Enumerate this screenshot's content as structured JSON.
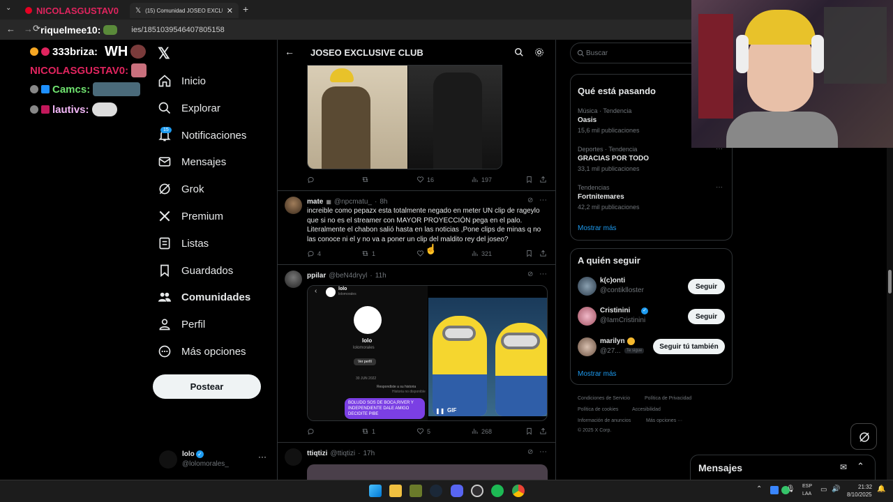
{
  "browser": {
    "tab1_label": "NICOLASGUSTAV0",
    "tab2_label": "(15) Comunidad JOSEO EXCLUS",
    "url_overlay": "riquelmee10:",
    "url": "ies/1851039546407805158"
  },
  "chat": {
    "lines": [
      {
        "user": "333briza:",
        "text": "WH",
        "color": "#ffffff"
      },
      {
        "user": "NICOLASGUSTAV0:",
        "text": "",
        "color": "#e0245e"
      },
      {
        "user": "Camcs:",
        "text": "",
        "color": "#6fe36f"
      },
      {
        "user": "lautivs:",
        "text": "",
        "color": "#f2b7f7"
      }
    ]
  },
  "nav": {
    "items": [
      {
        "label": "Inicio",
        "icon": "home-icon"
      },
      {
        "label": "Explorar",
        "icon": "search-icon"
      },
      {
        "label": "Notificaciones",
        "icon": "bell-icon",
        "badge": "15"
      },
      {
        "label": "Mensajes",
        "icon": "mail-icon"
      },
      {
        "label": "Grok",
        "icon": "grok-icon"
      },
      {
        "label": "Premium",
        "icon": "x-icon"
      },
      {
        "label": "Listas",
        "icon": "list-icon"
      },
      {
        "label": "Guardados",
        "icon": "bookmark-icon"
      },
      {
        "label": "Comunidades",
        "icon": "people-icon"
      },
      {
        "label": "Perfil",
        "icon": "person-icon"
      },
      {
        "label": "Más opciones",
        "icon": "more-icon"
      }
    ],
    "post_label": "Postear",
    "account_name": "lolo",
    "account_handle": "@lolomorales_"
  },
  "header": {
    "title": "JOSEO EXCLUSIVE CLUB"
  },
  "tweets": [
    {
      "replies": "",
      "retweets": "",
      "likes": "16",
      "views": "197"
    },
    {
      "name": "mate",
      "handle": "@npcmatu_",
      "time": "8h",
      "text": "increible como pepazx esta totalmente negado en meter UN clip de rageylo que si no es el streamer con MAYOR PROYECCIÓN pega en el palo. Literalmente el chabon salió hasta en las noticias ,Pone clips de minas q no las conoce ni el y no va a poner un clip del maldito rey del joseo?",
      "replies": "4",
      "retweets": "1",
      "likes": "",
      "views": "321"
    },
    {
      "name": "ppilar",
      "handle": "@beN4drγyl",
      "time": "11h",
      "replies": "",
      "retweets": "1",
      "likes": "5",
      "views": "268",
      "embed": {
        "profile_name": "lolo",
        "profile_handle": "lolomorales",
        "profile_name_big": "lolo",
        "profile_handle_big": "lolomorales",
        "view_profile": "Ver perfil",
        "date": "30 JUN 2022",
        "reply_note": "Respondiste a su historia",
        "reply_note2": "Historia no disponible",
        "message": "BOLUDO SOS DE BOCA,RIVER Y INDEPENDIENTE DALE AMIGO DECIDITE PIBE",
        "gif_label": "GIF"
      }
    },
    {
      "name": "ttiqtizi",
      "handle": "@ttiqtizi",
      "time": "17h"
    }
  ],
  "search": {
    "placeholder": "Buscar"
  },
  "trends": {
    "title": "Qué está pasando",
    "items": [
      {
        "category": "Música · Tendencia",
        "name": "Oasis",
        "count": "15,6 mil publicaciones"
      },
      {
        "category": "Deportes · Tendencia",
        "name": "GRACIAS POR TODO",
        "count": "33,1 mil publicaciones"
      },
      {
        "category": "Tendencias",
        "name": "Fortnitemares",
        "count": "42,2 mil publicaciones"
      }
    ],
    "show_more": "Mostrar más"
  },
  "who_to_follow": {
    "title": "A quién seguir",
    "items": [
      {
        "name": "k(c)onti",
        "handle": "@contiklloster",
        "button": "Seguir"
      },
      {
        "name": "Cristinini",
        "handle": "@IamCristinini",
        "button": "Seguir"
      },
      {
        "name": "marilyn",
        "handle": "@27...",
        "badge": "Te sigue",
        "button": "Seguir tú también"
      }
    ],
    "show_more": "Mostrar más"
  },
  "footer": {
    "terms": "Condiciones de Servicio",
    "privacy": "Política de Privacidad",
    "cookies": "Política de cookies",
    "accessibility": "Accesibilidad",
    "ads": "Información de anuncios",
    "more": "Más opciones ···",
    "copyright": "© 2025 X Corp."
  },
  "messages_drawer": {
    "title": "Mensajes"
  },
  "taskbar": {
    "lang1": "ESP",
    "lang2": "LAA",
    "time": "21:32",
    "date": "8/10/2025"
  }
}
